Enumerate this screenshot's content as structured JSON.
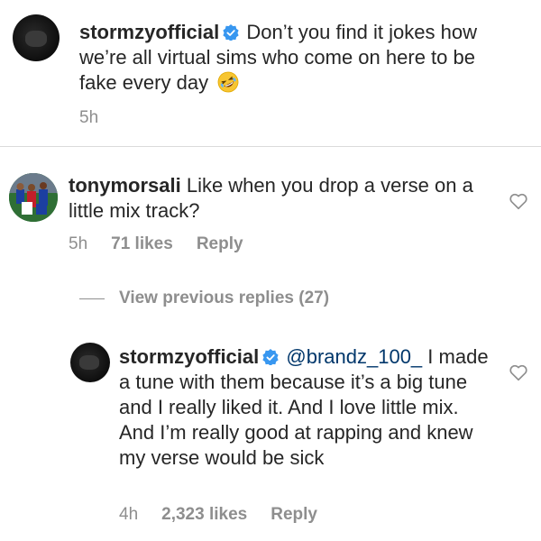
{
  "comments": [
    {
      "username": "stormzyofficial",
      "text": "Don’t you find it jokes how we’re all virtual sims who come on here to be fake every day",
      "time": "5h",
      "emoji": "rolling-on-floor-laughing-emoji"
    },
    {
      "username": "tonymorsali",
      "text": "Like when you drop a verse on a little mix track?",
      "time": "5h",
      "likes": "71 likes",
      "reply": "Reply"
    }
  ],
  "view_previous_replies": "View previous replies (27)",
  "reply": {
    "username": "stormzyofficial",
    "mention": "@brandz_100_",
    "text": "I made a tune with them because it’s a big tune and I really liked it. And I love little mix. And I’m really good at rapping and knew my verse would be sick",
    "time": "4h",
    "likes": "2,323 likes",
    "reply": "Reply"
  },
  "colors": {
    "text": "#262626",
    "meta": "#8e8e8e",
    "verified": "#3897f0",
    "divider": "#dbdbdb"
  }
}
